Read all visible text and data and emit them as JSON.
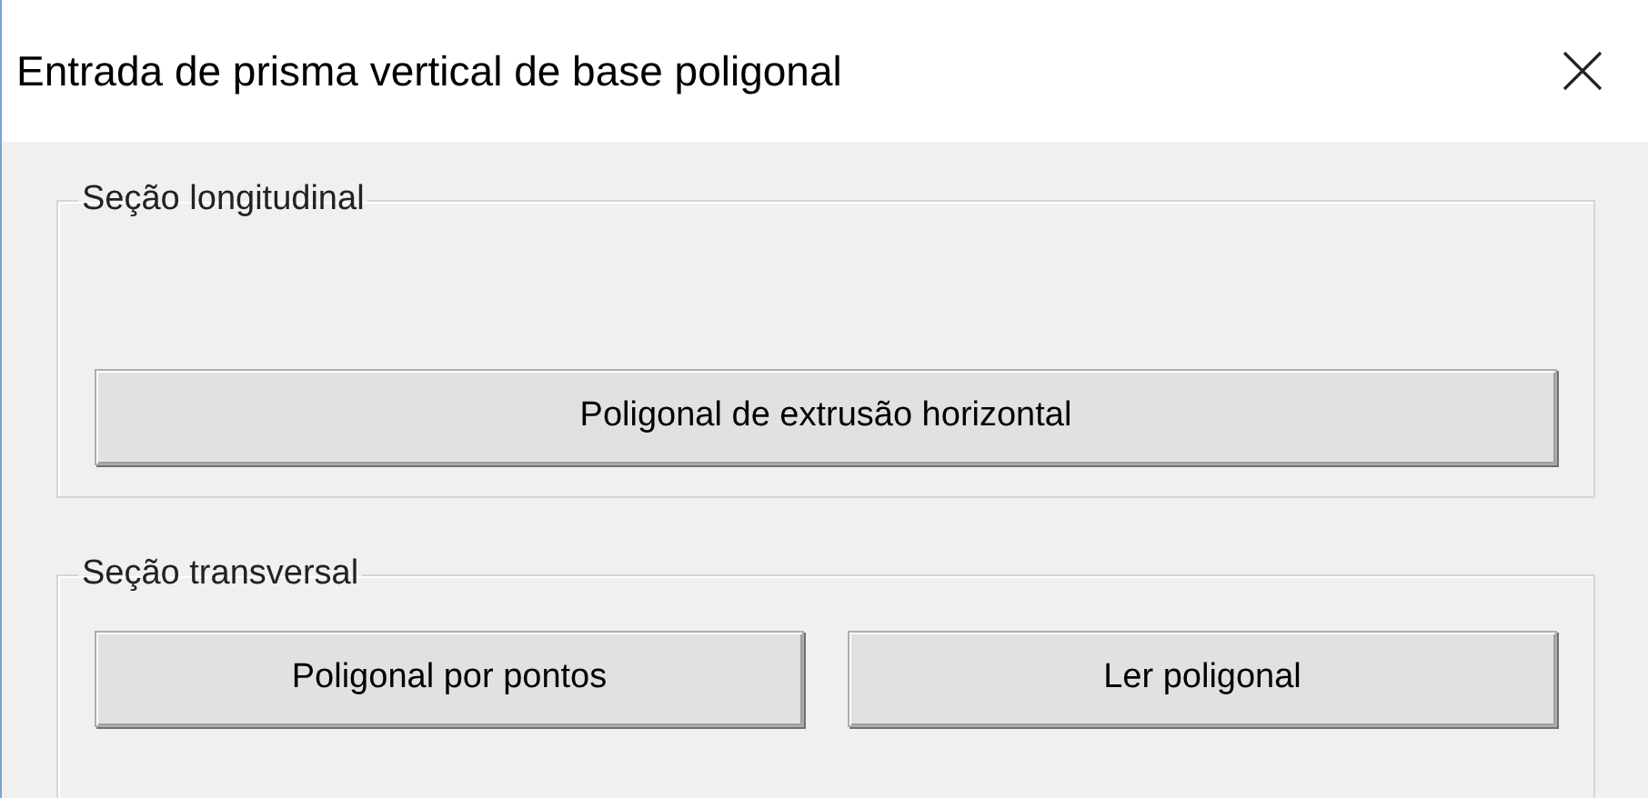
{
  "window": {
    "title": "Entrada de prisma vertical de base poligonal"
  },
  "sections": [
    {
      "title": "Seção longitudinal",
      "kind": "spaced",
      "buttons": [
        "Poligonal de extrusão horizontal"
      ]
    },
    {
      "title": "Seção transversal",
      "kind": "compact",
      "buttons": [
        "Poligonal por pontos",
        "Ler poligonal"
      ]
    }
  ]
}
